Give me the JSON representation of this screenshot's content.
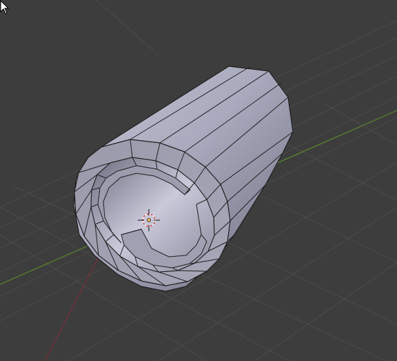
{
  "viewport": {
    "background_color": "#3d3d3d",
    "grid_color": "#505050",
    "x_axis_color": "#5b8a2c",
    "y_axis_color": "#7a2f35",
    "mesh_fill_light": "#b4b4c8",
    "mesh_fill_dark": "#7d7d8f",
    "mesh_edge_color": "#1e1e1e",
    "origin_color": "#f7b15a",
    "cursor_3d_colors": [
      "#ffffff",
      "#e03a3a"
    ]
  },
  "object": {
    "icon": "cylinder-mesh-icon",
    "shading": "solid"
  },
  "pointer": {
    "icon": "mouse-pointer-icon"
  }
}
